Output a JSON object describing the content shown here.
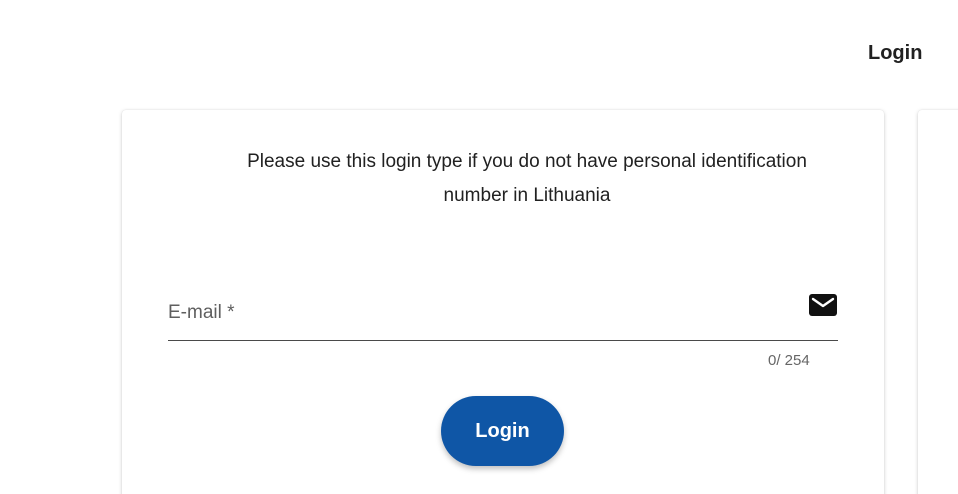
{
  "header": {
    "title": "Login"
  },
  "login_card": {
    "description": "Please use this login type if you do not have personal identification number in Lithuania",
    "email": {
      "label": "E-mail *",
      "value": "",
      "icon": "mail-icon",
      "counter": "0/ 254"
    },
    "login_button_label": "Login"
  },
  "colors": {
    "primary": "#0f56a6",
    "text": "#212121",
    "muted": "#666666"
  }
}
